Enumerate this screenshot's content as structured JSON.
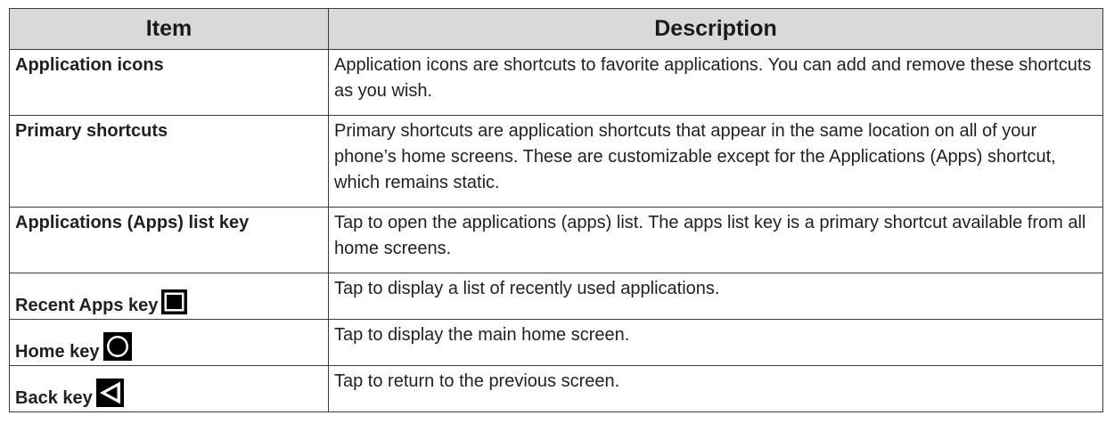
{
  "table": {
    "headers": {
      "item": "Item",
      "description": "Description"
    },
    "rows": [
      {
        "item": "Application icons",
        "description": "Application icons are shortcuts to favorite applications. You can add and remove these shortcuts as you wish."
      },
      {
        "item": "Primary shortcuts",
        "description": "Primary shortcuts are application shortcuts that appear in the same location on all of your phone’s home screens. These are customizable except for the Applications (Apps) shortcut, which remains static."
      },
      {
        "item": "Applications (Apps) list key",
        "description": "Tap to open the applications (apps) list. The apps list key is a primary shortcut available from all home screens."
      },
      {
        "item": "Recent Apps key",
        "icon": "recent-apps-square-icon",
        "description": "Tap to display a list of recently used applications."
      },
      {
        "item": "Home key",
        "icon": "home-circle-icon",
        "description": "Tap to display the main home screen."
      },
      {
        "item": "Back key",
        "icon": "back-triangle-icon",
        "description": "Tap to return to the previous screen."
      }
    ]
  }
}
